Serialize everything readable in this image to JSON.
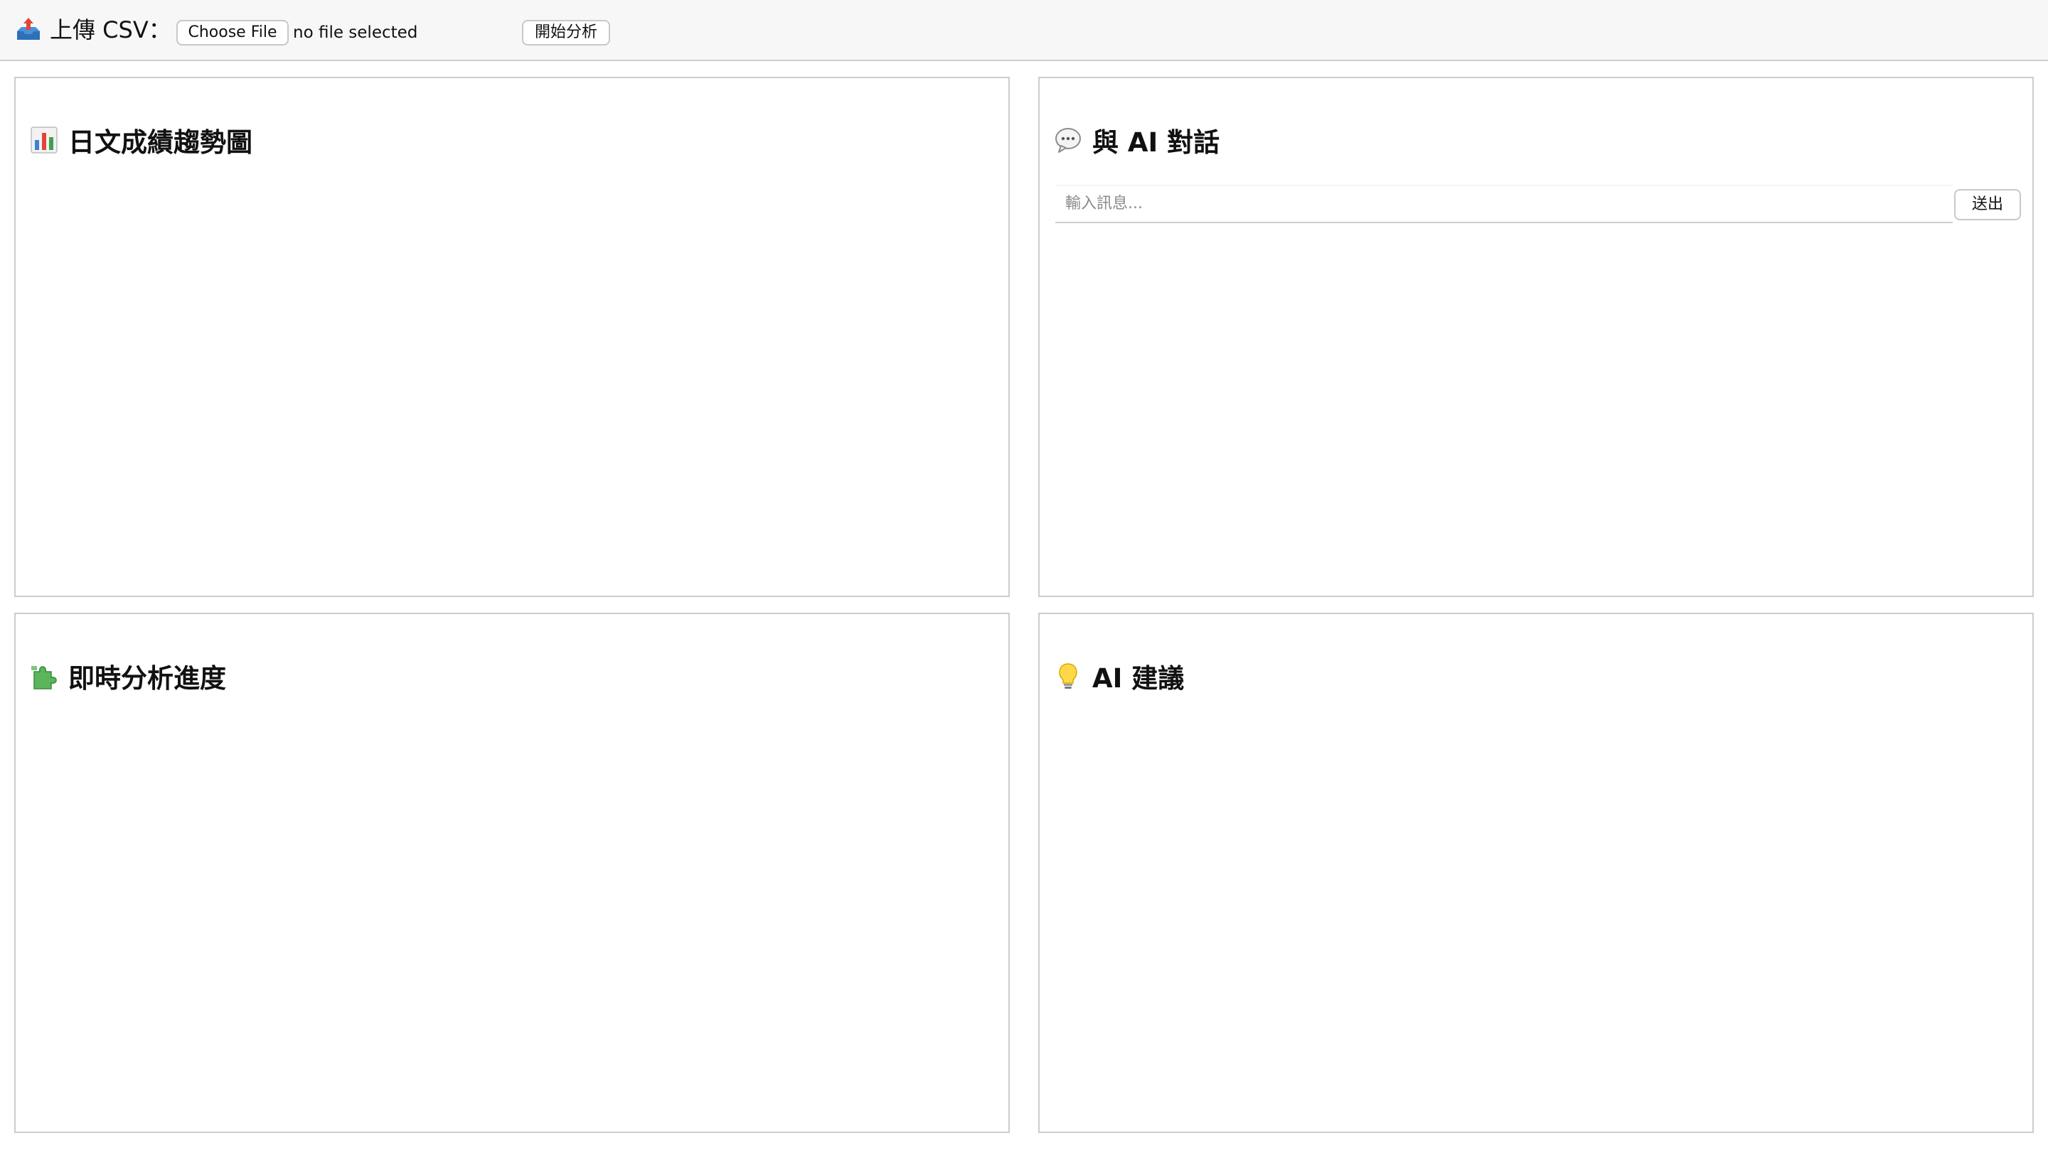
{
  "toolbar": {
    "upload_label": "上傳 CSV：",
    "upload_icon": "inbox-tray-icon",
    "choose_file_label": "Choose File",
    "file_status": "no file selected",
    "analyze_label": "開始分析"
  },
  "panels": {
    "chart": {
      "title": "日文成績趨勢圖",
      "icon": "bar-chart-icon"
    },
    "chat": {
      "title": "與 AI 對話",
      "icon": "speech-bubble-icon",
      "input_placeholder": "輸入訊息...",
      "input_value": "",
      "send_label": "送出"
    },
    "progress": {
      "title": "即時分析進度",
      "icon": "puzzle-piece-icon"
    },
    "advice": {
      "title": "AI 建議",
      "icon": "lightbulb-icon"
    }
  },
  "colors": {
    "toolbar_bg": "#f7f7f7",
    "panel_border": "#cccccc",
    "button_border": "#c8c8c8"
  }
}
